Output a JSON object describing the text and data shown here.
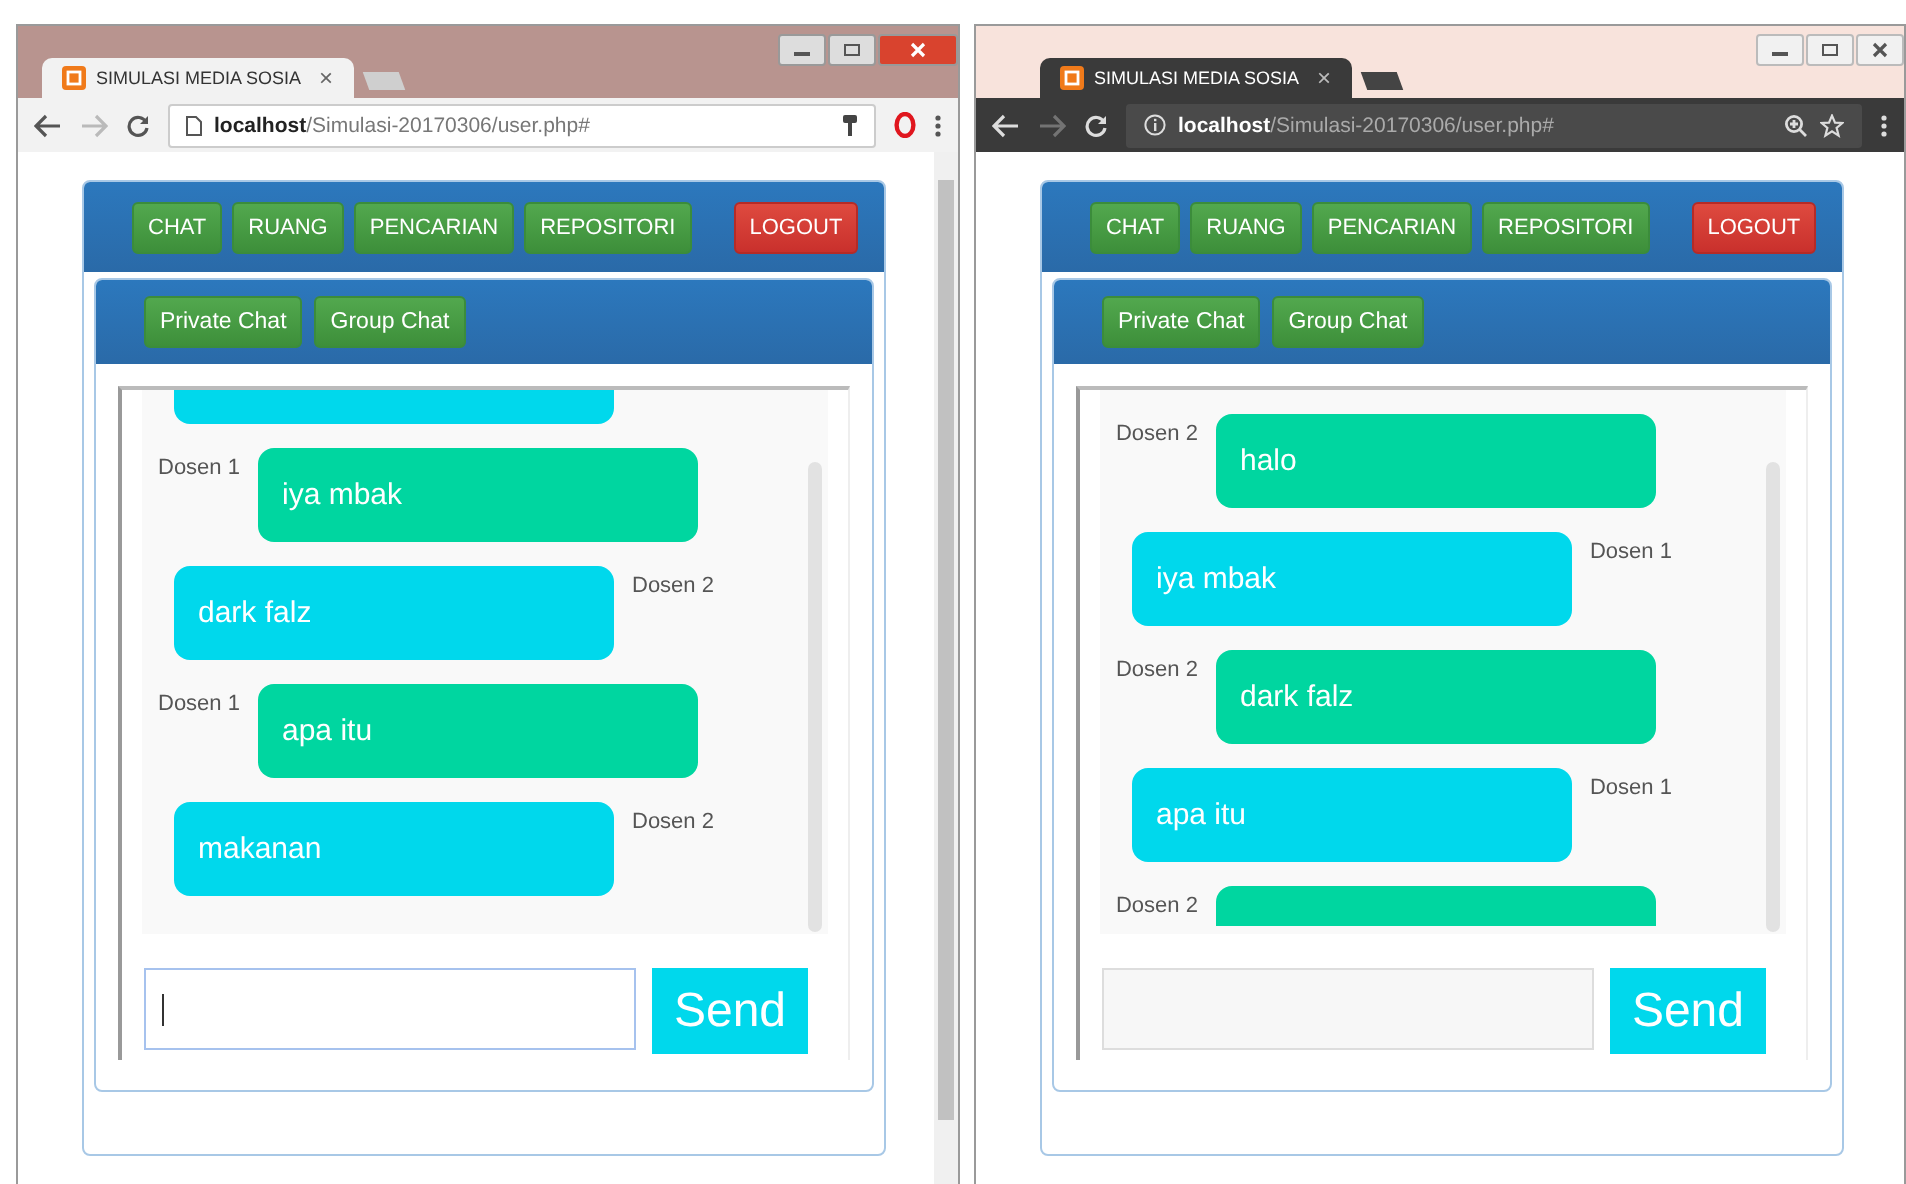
{
  "windows": [
    {
      "kind": "light",
      "tab": {
        "title": "SIMULASI MEDIA SOSIA",
        "close": "×"
      },
      "address": {
        "host": "localhost",
        "path": "/Simulasi-20170306/user.php#"
      },
      "extensions": [
        {
          "kind": "key"
        },
        {
          "kind": "opera"
        }
      ],
      "nav": [
        {
          "label": "CHAT",
          "kind": "primary"
        },
        {
          "label": "RUANG",
          "kind": "primary"
        },
        {
          "label": "PENCARIAN",
          "kind": "primary"
        },
        {
          "label": "REPOSITORI",
          "kind": "primary"
        },
        {
          "label": "LOGOUT",
          "kind": "danger"
        }
      ],
      "subnav": [
        "Private Chat",
        "Group Chat"
      ],
      "messages": [
        {
          "kind": "sent"
        },
        {
          "kind": "received",
          "sender": "Dosen 1",
          "text": "iya mbak"
        },
        {
          "kind": "sent",
          "sender": "Dosen 2",
          "text": "dark falz"
        },
        {
          "kind": "received",
          "sender": "Dosen 1",
          "text": "apa itu"
        },
        {
          "kind": "sent",
          "sender": "Dosen 2",
          "text": "makanan"
        }
      ],
      "input": {
        "focused": true
      },
      "send": "Send"
    },
    {
      "kind": "dark",
      "tab": {
        "title": "SIMULASI MEDIA SOSIA",
        "close": "×"
      },
      "address": {
        "host": "localhost",
        "path": "/Simulasi-20170306/user.php#"
      },
      "extensions": [
        {
          "kind": "zoom"
        },
        {
          "kind": "star"
        }
      ],
      "nav": [
        {
          "label": "CHAT",
          "kind": "primary"
        },
        {
          "label": "RUANG",
          "kind": "primary"
        },
        {
          "label": "PENCARIAN",
          "kind": "primary"
        },
        {
          "label": "REPOSITORI",
          "kind": "primary"
        },
        {
          "label": "LOGOUT",
          "kind": "danger"
        }
      ],
      "subnav": [
        "Private Chat",
        "Group Chat"
      ],
      "messages": [
        {
          "kind": "received",
          "sender": "Dosen 2",
          "text": "halo"
        },
        {
          "kind": "sent",
          "sender": "Dosen 1",
          "text": "iya mbak"
        },
        {
          "kind": "received",
          "sender": "Dosen 2",
          "text": "dark falz"
        },
        {
          "kind": "sent",
          "sender": "Dosen 1",
          "text": "apa itu"
        },
        {
          "kind": "received",
          "sender": "Dosen 2"
        }
      ],
      "input": {
        "focused": false
      },
      "send": "Send"
    }
  ]
}
